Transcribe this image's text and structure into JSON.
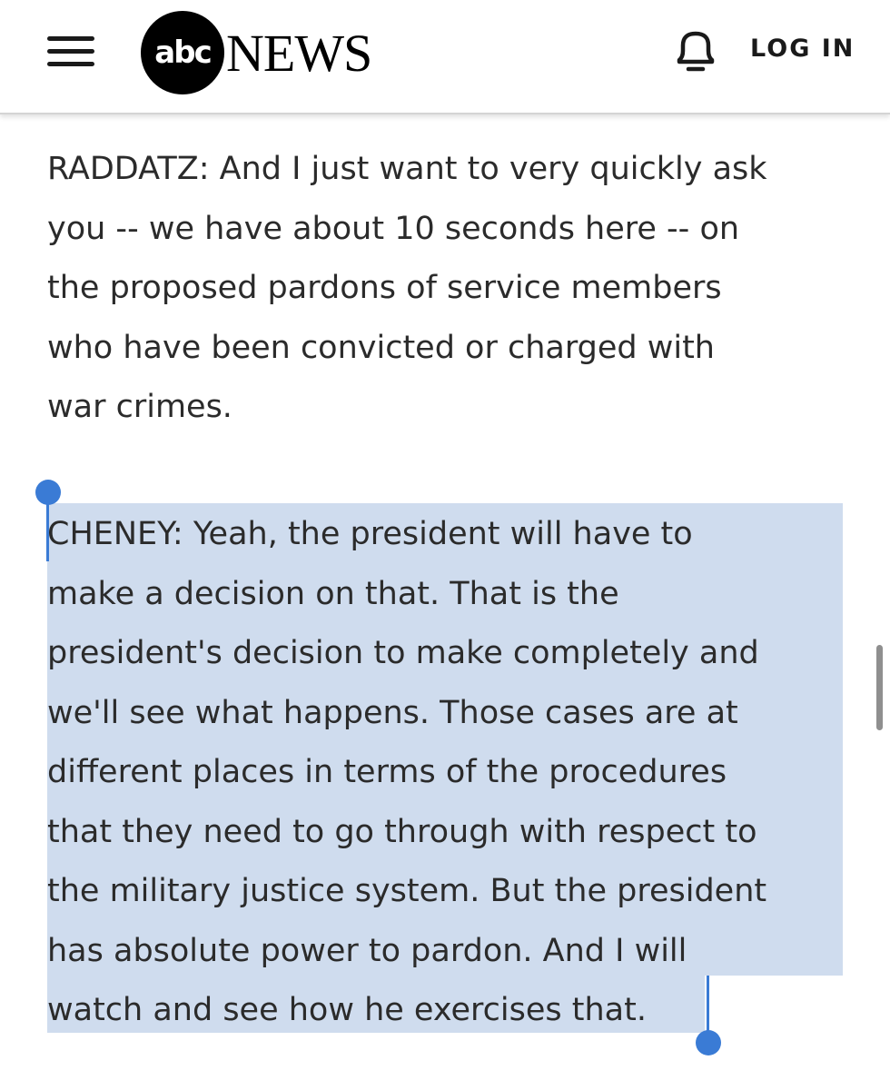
{
  "header": {
    "logo_mark": "abc",
    "logo_word": "NEWS",
    "login_label": "LOG IN",
    "icons": {
      "menu": "hamburger-menu-icon",
      "bell": "bell-icon"
    }
  },
  "article": {
    "paragraphs": [
      {
        "speaker": "RADDATZ",
        "lines": [
          "RADDATZ: And I just want to very quickly ask",
          "you -- we have about 10 seconds here -- on",
          "the proposed pardons of service members",
          "who have been convicted or charged with",
          "war crimes."
        ]
      },
      {
        "speaker": "CHENEY",
        "selected": true,
        "lines": [
          "CHENEY: Yeah, the president will have to",
          "make a decision on that. That is the",
          "president's decision to make completely and",
          "we'll see what happens. Those cases are at",
          "different places in terms of the procedures",
          "that they need to go through with respect to",
          "the military justice system. But the president",
          "has absolute power to pardon. And I will",
          "watch and see how he exercises that."
        ]
      }
    ]
  },
  "colors": {
    "selection_highlight": "#cfdcee",
    "selection_handle": "#3a7bd5",
    "text": "#2b2b2b"
  }
}
